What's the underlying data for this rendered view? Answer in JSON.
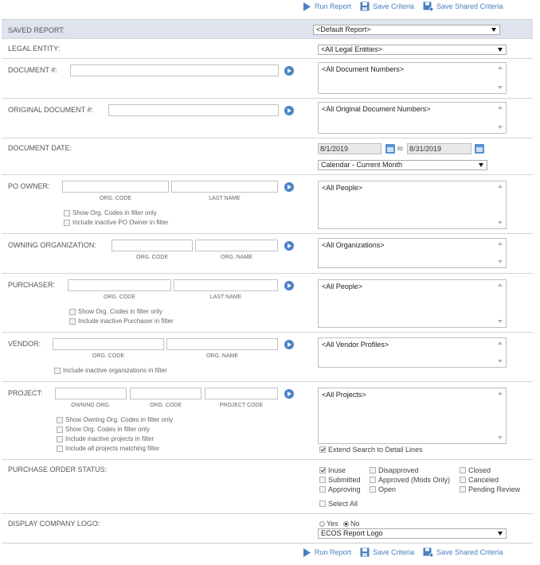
{
  "toolbar": {
    "run_report": "Run Report",
    "save_criteria": "Save Criteria",
    "save_shared_criteria": "Save Shared Criteria"
  },
  "saved_report": {
    "label": "SAVED REPORT:",
    "value": "<Default Report>"
  },
  "legal_entity": {
    "label": "LEGAL ENTITY:",
    "value": "<All Legal Entities>"
  },
  "document_no": {
    "label": "DOCUMENT #:",
    "list": "<All Document Numbers>"
  },
  "original_document_no": {
    "label": "ORIGINAL DOCUMENT #:",
    "list": "<All Original Document Numbers>"
  },
  "document_date": {
    "label": "DOCUMENT DATE:",
    "from": "8/1/2019",
    "to_label": "to",
    "to": "8/31/2019",
    "range": "Calendar - Current Month"
  },
  "po_owner": {
    "label": "PO OWNER:",
    "sub1": "ORG. CODE",
    "sub2": "LAST NAME",
    "cb1": "Show Org. Codes in filter only",
    "cb2": "Include inactive PO Owner in filter",
    "list": "<All People>"
  },
  "owning_org": {
    "label": "OWNING ORGANIZATION:",
    "sub1": "ORG. CODE",
    "sub2": "ORG. NAME",
    "list": "<All Organizations>"
  },
  "purchaser": {
    "label": "PURCHASER:",
    "sub1": "ORG. CODE",
    "sub2": "LAST NAME",
    "cb1": "Show Org. Codes in filter only",
    "cb2": "Include inactive Purchaser in filter",
    "list": "<All People>"
  },
  "vendor": {
    "label": "VENDOR:",
    "sub1": "ORG. CODE",
    "sub2": "ORG. NAME",
    "cb1": "Include inactive organizations in filter",
    "list": "<All Vendor Profiles>"
  },
  "project": {
    "label": "PROJECT:",
    "sub1": "OWNING ORG.",
    "sub2": "ORG. CODE",
    "sub3": "PROJECT CODE",
    "cb1": "Show Owning Org. Codes in filter only",
    "cb2": "Show Org. Codes in filter only",
    "cb3": "Include inactive projects in filter",
    "cb4": "Include all projects matching filter",
    "list": "<All Projects>",
    "extend": "Extend Search to Detail Lines",
    "extend_checked": true
  },
  "po_status": {
    "label": "PURCHASE ORDER STATUS:",
    "inuse": "Inuse",
    "disapproved": "Disapproved",
    "closed": "Closed",
    "submitted": "Submitted",
    "approved": "Approved (Mods Only)",
    "canceled": "Canceled",
    "approving": "Approving",
    "open": "Open",
    "pending": "Pending Review",
    "select_all": "Select All",
    "inuse_checked": true
  },
  "logo": {
    "label": "DISPLAY COMPANY LOGO:",
    "yes": "Yes",
    "no": "No",
    "value": "ECOS Report Logo",
    "selected": "No"
  },
  "colors": {
    "accent": "#4a7fc1",
    "header_bg": "#dfe3ee"
  }
}
